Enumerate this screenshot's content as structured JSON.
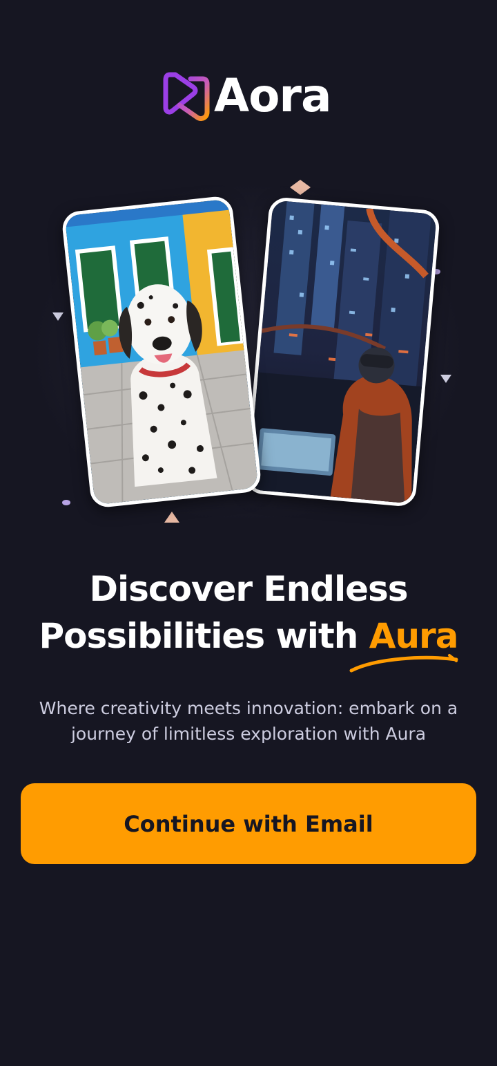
{
  "app": {
    "name": "Aora"
  },
  "logo": {
    "icon": "play-logo-icon",
    "gradient_colors": [
      "#9b3fe6",
      "#ff9c01"
    ]
  },
  "hero": {
    "cards": [
      {
        "icon": "dalmatian-photo"
      },
      {
        "icon": "cyberpunk-city-photo"
      }
    ]
  },
  "headline": {
    "line1": "Discover Endless",
    "line2_prefix": "Possibilities with ",
    "accent": "Aura"
  },
  "subtitle": "Where creativity meets innovation: embark on a journey of limitless exploration with Aura",
  "cta": {
    "label": "Continue with Email"
  },
  "colors": {
    "background": "#161622",
    "accent": "#ff9c01",
    "text_secondary": "#cdcde0"
  }
}
